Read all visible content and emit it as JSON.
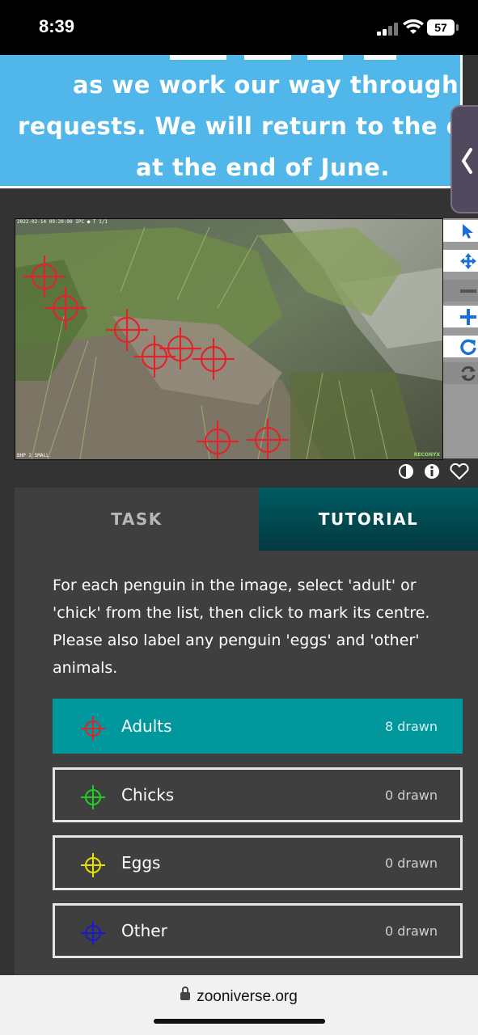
{
  "status": {
    "time": "8:39",
    "battery": "57"
  },
  "banner": {
    "lines": [
      "as we work our way through",
      "requests. We will return to the of",
      "at the end of June."
    ]
  },
  "camera": {
    "header": "2022-02-14 09:20:00   IPC ●   T 1/1",
    "footer": "BHP 2 SMALL",
    "brand": "RECONYX"
  },
  "toolbar": {
    "tools": [
      "pointer-icon",
      "move-icon",
      "zoom-out-icon",
      "zoom-in-icon",
      "rotate-icon",
      "reset-icon"
    ]
  },
  "tabs": {
    "task": "TASK",
    "tutorial": "TUTORIAL"
  },
  "instructions": "For each penguin in the image, select 'adult' or 'chick' from the list, then click to mark its centre. Please also label any penguin 'eggs' and 'other' animals.",
  "options": [
    {
      "label": "Adults",
      "count": "8 drawn",
      "color": "#e0242b",
      "active": true
    },
    {
      "label": "Chicks",
      "count": "0 drawn",
      "color": "#22cc22",
      "active": false
    },
    {
      "label": "Eggs",
      "count": "0 drawn",
      "color": "#e8e000",
      "active": false
    },
    {
      "label": "Other",
      "count": "0 drawn",
      "color": "#1a1acc",
      "active": false
    }
  ],
  "browser": {
    "url": "zooniverse.org"
  },
  "colors": {
    "banner": "#51b7ea",
    "accent": "#00979d",
    "marker": "#e0242b"
  }
}
